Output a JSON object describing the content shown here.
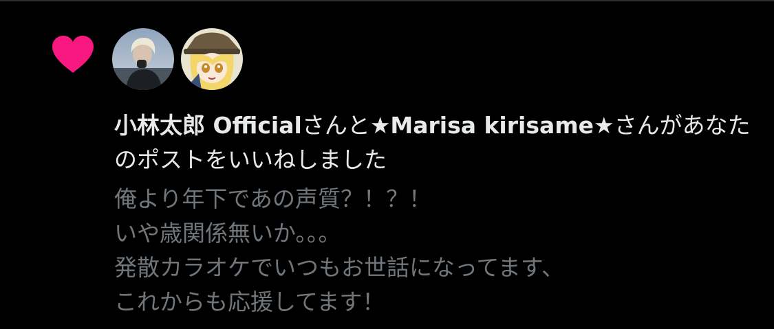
{
  "notification": {
    "type": "like",
    "accent_color": "#f91880",
    "icon": "heart-icon",
    "avatars": [
      {
        "name": "avatar-user-1"
      },
      {
        "name": "avatar-user-2"
      }
    ],
    "users": [
      {
        "name": "小林太郎 Official"
      },
      {
        "name": "★Marisa kirisame★"
      }
    ],
    "connector_1": "さんと",
    "connector_2": "さんがあなたのポストをいいねしました"
  },
  "post": {
    "lines": [
      "俺より年下であの声質？！？！",
      "いや歳関係無いか。。。",
      "発散カラオケでいつもお世話になってます、",
      "これからも応援してます！"
    ]
  }
}
